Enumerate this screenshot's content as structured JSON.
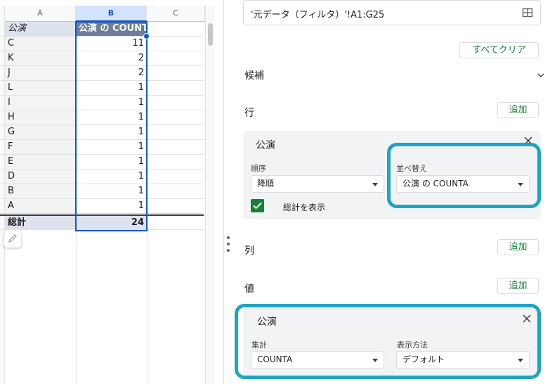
{
  "sheet": {
    "columns": [
      "A",
      "B",
      "C"
    ],
    "header": {
      "a": "公演",
      "b": "公演 の COUNTA"
    },
    "rows": [
      {
        "a": "C",
        "b": "11"
      },
      {
        "a": "K",
        "b": "2"
      },
      {
        "a": "J",
        "b": "2"
      },
      {
        "a": "L",
        "b": "1"
      },
      {
        "a": "I",
        "b": "1"
      },
      {
        "a": "H",
        "b": "1"
      },
      {
        "a": "G",
        "b": "1"
      },
      {
        "a": "F",
        "b": "1"
      },
      {
        "a": "E",
        "b": "1"
      },
      {
        "a": "D",
        "b": "1"
      },
      {
        "a": "B",
        "b": "1"
      },
      {
        "a": "A",
        "b": "1"
      }
    ],
    "total": {
      "a": "総計",
      "b": "24"
    }
  },
  "panel": {
    "range": "'元データ（フィルタ）'!A1:G25",
    "clear_all": "すべてクリア",
    "suggestions": "候補",
    "rows_label": "行",
    "columns_label": "列",
    "values_label": "値",
    "add": "追加",
    "row_card": {
      "title": "公演",
      "order_label": "順序",
      "order_value": "降順",
      "sort_label": "並べ替え",
      "sort_value": "公演 の COUNTA",
      "show_totals": "総計を表示"
    },
    "value_card": {
      "title": "公演",
      "summarize_label": "集計",
      "summarize_value": "COUNTA",
      "display_label": "表示方法",
      "display_value": "デフォルト"
    }
  },
  "colors": {
    "accent": "#0b57d0",
    "highlight": "#1da5c2",
    "green": "#188038"
  }
}
